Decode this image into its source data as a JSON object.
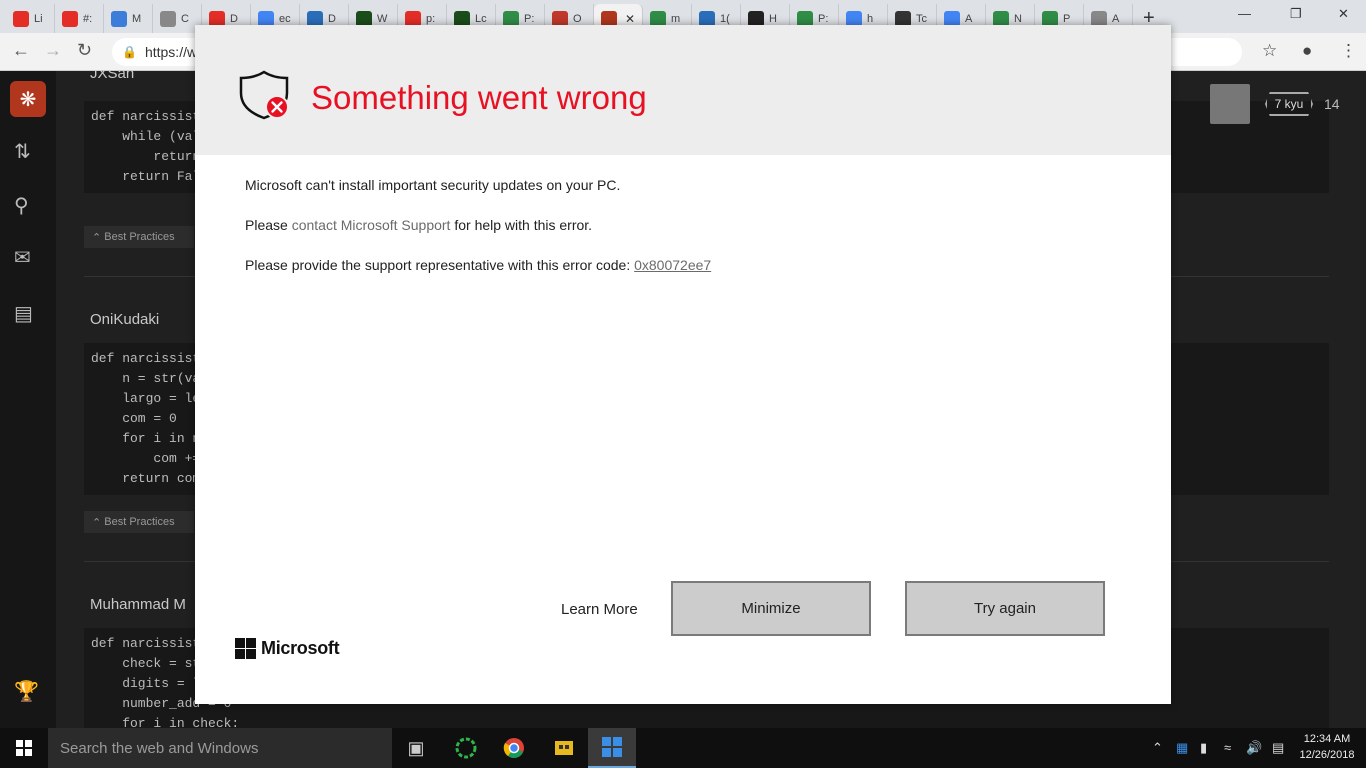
{
  "browser": {
    "tabs": [
      {
        "label": "Li",
        "color": "#e52d27"
      },
      {
        "label": "#:",
        "color": "#e52d27"
      },
      {
        "label": "M",
        "color": "#3b7dd8"
      },
      {
        "label": "C",
        "color": "#888888"
      },
      {
        "label": "D",
        "color": "#e52d27"
      },
      {
        "label": "ec",
        "color": "#4285f4"
      },
      {
        "label": "D",
        "color": "#2a6ebb"
      },
      {
        "label": "W",
        "color": "#1b4d1b"
      },
      {
        "label": "p:",
        "color": "#e52d27"
      },
      {
        "label": "Lc",
        "color": "#1b4d1b"
      },
      {
        "label": "P:",
        "color": "#2f8d46"
      },
      {
        "label": "O",
        "color": "#c0392b"
      },
      {
        "label": "",
        "color": "#b1361e",
        "active": true
      },
      {
        "label": "m",
        "color": "#2f8d46"
      },
      {
        "label": "1(",
        "color": "#2a6ebb"
      },
      {
        "label": "H",
        "color": "#222222"
      },
      {
        "label": "P:",
        "color": "#2f8d46"
      },
      {
        "label": "h",
        "color": "#4285f4"
      },
      {
        "label": "Tc",
        "color": "#333333"
      },
      {
        "label": "A",
        "color": "#4285f4"
      },
      {
        "label": "N",
        "color": "#2f8d46"
      },
      {
        "label": "P",
        "color": "#2f8d46"
      },
      {
        "label": "A",
        "color": "#888888"
      }
    ],
    "url": "https://w"
  },
  "page_behind": {
    "users": [
      "JXSan",
      "OniKudaki",
      "Muhammad M"
    ],
    "best_practices_label": "Best Practices",
    "rank_badge": "7 kyu",
    "honor": "14",
    "code_blocks": [
      [
        "def narcissisti",
        "    while (valu",
        "        return",
        "    return Fals"
      ],
      [
        "def narcissisti",
        "    n = str(val",
        "    largo = len",
        "    com = 0",
        "    for i in n:",
        "        com +=",
        "    return com"
      ],
      [
        "def narcissisti",
        "    check = st",
        "    digits = le",
        "    number_add = 0",
        "    for i in check:"
      ]
    ]
  },
  "dialog": {
    "title": "Something went wrong",
    "line1": "Microsoft can't install important security updates on your PC.",
    "line2_prefix": "Please ",
    "line2_link": "contact Microsoft Support",
    "line2_suffix": " for help with this error.",
    "line3_prefix": "Please provide the support representative with this error code: ",
    "error_code": "0x80072ee7",
    "learn_more": "Learn More",
    "minimize": "Minimize",
    "try_again": "Try again",
    "brand": "Microsoft",
    "colors": {
      "title": "#e81123",
      "error_badge": "#e81123"
    }
  },
  "taskbar": {
    "search_placeholder": "Search the web and Windows",
    "time": "12:34 AM",
    "date": "12/26/2018"
  }
}
